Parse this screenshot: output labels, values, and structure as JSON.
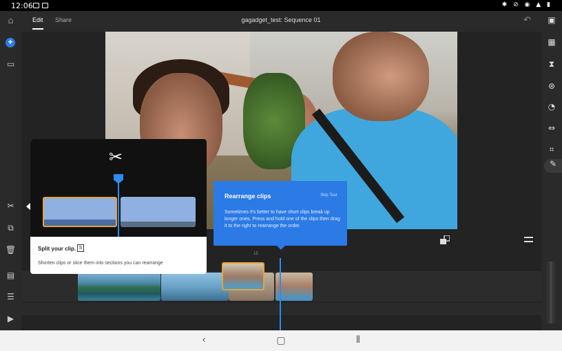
{
  "status": {
    "time": "12:06",
    "right_icons": "✱ ⊘ ◉ ▲ ▮"
  },
  "topbar": {
    "tabs": [
      {
        "label": "Edit",
        "active": true
      },
      {
        "label": "Share",
        "active": false
      }
    ],
    "title": "gagadget_test: Sequence 01"
  },
  "timeline": {
    "timecode_label": "15"
  },
  "tooltip_split": {
    "title": "Split your clip.",
    "shortcut": "S",
    "description": "Shorten clips or slice them into sections you can rearrange"
  },
  "tooltip_rearrange": {
    "title": "Rearrange clips",
    "skip_label": "Skip Tour",
    "description": "Sometimes it's better to have short clips break up longer ones. Press and hold one of the clips then drag it to the right to rearrange the order."
  },
  "colors": {
    "accent": "#2b7ae5",
    "playhead": "#2b8cf2",
    "selection": "#e8a33a"
  },
  "icons": {
    "left": [
      "home-icon",
      "add-media-icon",
      "library-icon",
      "split-icon",
      "duplicate-icon",
      "delete-icon",
      "track-icon",
      "list-icon",
      "add-track-icon"
    ],
    "right": [
      "comment-icon",
      "titles-icon",
      "transitions-icon",
      "color-icon",
      "speed-icon",
      "fit-icon",
      "crop-icon",
      "pencil-icon"
    ]
  }
}
